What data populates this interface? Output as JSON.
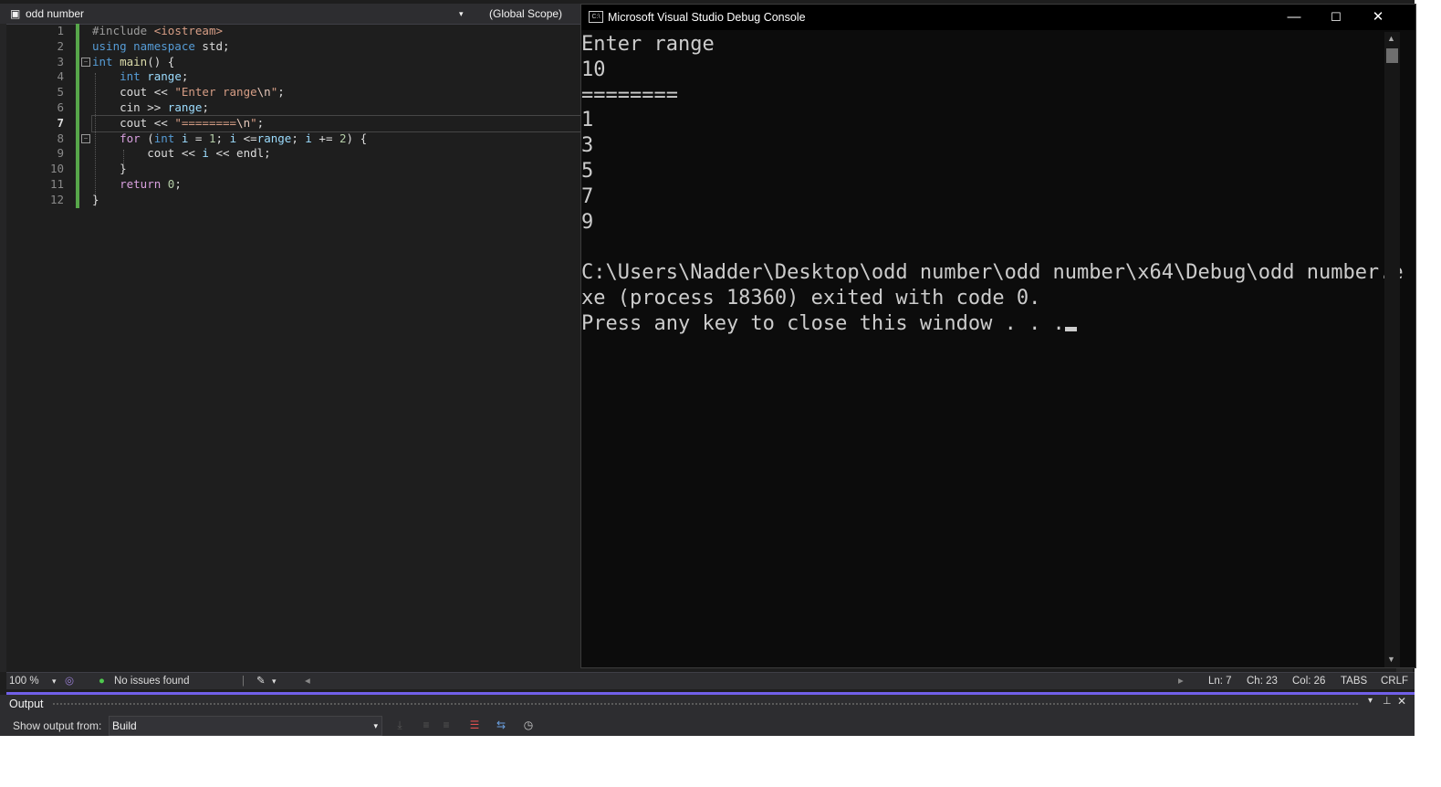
{
  "editor": {
    "file_dropdown": "odd number",
    "scope_dropdown": "(Global Scope)",
    "line_numbers": [
      "1",
      "2",
      "3",
      "4",
      "5",
      "6",
      "7",
      "8",
      "9",
      "10",
      "11",
      "12"
    ],
    "current_line": 7
  },
  "console": {
    "title": "Microsoft Visual Studio Debug Console",
    "lines": [
      "Enter range",
      "10",
      "========",
      "1",
      "3",
      "5",
      "7",
      "9",
      "",
      "C:\\Users\\Nadder\\Desktop\\odd number\\odd number\\x64\\Debug\\odd number.e",
      "xe (process 18360) exited with code 0.",
      "Press any key to close this window . . ."
    ]
  },
  "status": {
    "zoom": "100 %",
    "issues": "No issues found",
    "ln": "Ln: 7",
    "ch": "Ch: 23",
    "col": "Col: 26",
    "tabs": "TABS",
    "eol": "CRLF"
  },
  "output": {
    "title": "Output",
    "show_from_label": "Show output from:",
    "source": "Build"
  },
  "colors": {
    "accent": "#7160e8",
    "green_change": "#57a64a",
    "console_bg": "#0c0c0c"
  }
}
